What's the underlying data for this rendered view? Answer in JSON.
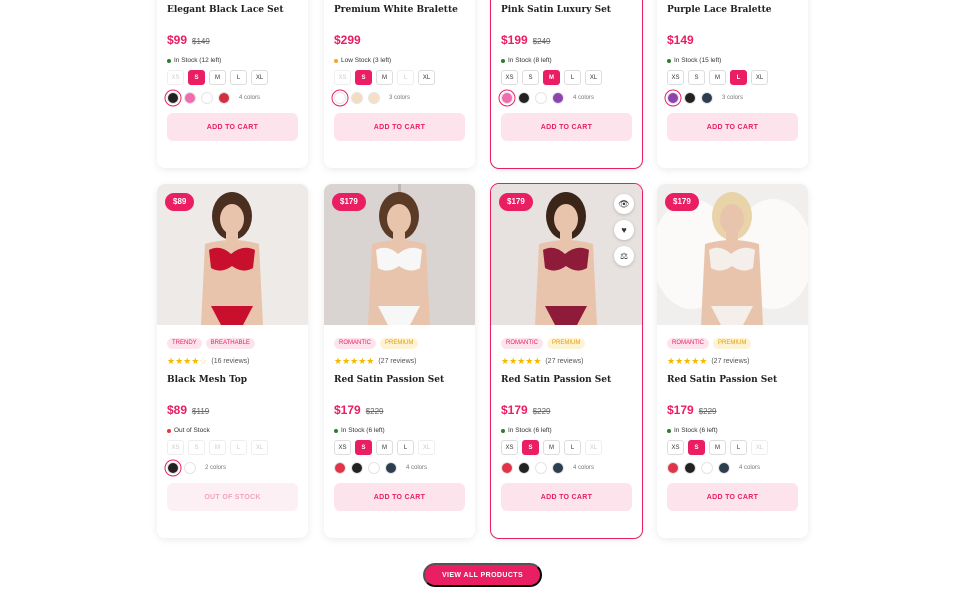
{
  "products_top": [
    {
      "title": "Elegant Black Lace Set",
      "price": "$99",
      "old_price": "$149",
      "stock": "In Stock (12 left)",
      "stock_color": "#2e7d32",
      "sizes": [
        {
          "label": "XS",
          "state": "disabled"
        },
        {
          "label": "S",
          "state": "active"
        },
        {
          "label": "M",
          "state": ""
        },
        {
          "label": "L",
          "state": ""
        },
        {
          "label": "XL",
          "state": ""
        }
      ],
      "colors": [
        "#222222",
        "#f06bb0",
        "#ffffff",
        "#d32f3f"
      ],
      "selected_color": 0,
      "color_count": "4 colors",
      "button": "ADD TO CART",
      "highlight": false
    },
    {
      "title": "Premium White Bralette",
      "price": "$299",
      "old_price": "",
      "stock": "Low Stock (3 left)",
      "stock_color": "#f5a623",
      "sizes": [
        {
          "label": "XS",
          "state": "disabled"
        },
        {
          "label": "S",
          "state": "active"
        },
        {
          "label": "M",
          "state": ""
        },
        {
          "label": "L",
          "state": "disabled"
        },
        {
          "label": "XL",
          "state": ""
        }
      ],
      "colors": [
        "#ffffff",
        "#f3dcc0",
        "#f5e0c6"
      ],
      "selected_color": 0,
      "color_count": "3 colors",
      "button": "ADD TO CART",
      "highlight": false
    },
    {
      "title": "Pink Satin Luxury Set",
      "price": "$199",
      "old_price": "$249",
      "stock": "In Stock (8 left)",
      "stock_color": "#2e7d32",
      "sizes": [
        {
          "label": "XS",
          "state": ""
        },
        {
          "label": "S",
          "state": ""
        },
        {
          "label": "M",
          "state": "active"
        },
        {
          "label": "L",
          "state": ""
        },
        {
          "label": "XL",
          "state": ""
        }
      ],
      "colors": [
        "#f06bb0",
        "#222222",
        "#ffffff",
        "#8e44ad"
      ],
      "selected_color": 0,
      "color_count": "4 colors",
      "button": "ADD TO CART",
      "highlight": true
    },
    {
      "title": "Purple Lace Bralette",
      "price": "$149",
      "old_price": "",
      "stock": "In Stock (15 left)",
      "stock_color": "#2e7d32",
      "sizes": [
        {
          "label": "XS",
          "state": ""
        },
        {
          "label": "S",
          "state": ""
        },
        {
          "label": "M",
          "state": ""
        },
        {
          "label": "L",
          "state": "active"
        },
        {
          "label": "XL",
          "state": ""
        }
      ],
      "colors": [
        "#8e44ad",
        "#222222",
        "#2c3e50"
      ],
      "selected_color": 0,
      "color_count": "3 colors",
      "button": "ADD TO CART",
      "highlight": false
    }
  ],
  "products_bottom": [
    {
      "badge": "$89",
      "tags": [
        {
          "label": "TRENDY",
          "style": "pink"
        },
        {
          "label": "BREATHABLE",
          "style": "pink"
        }
      ],
      "stars": 4,
      "reviews": "(16 reviews)",
      "title": "Black Mesh Top",
      "price": "$89",
      "old_price": "$119",
      "stock": "Out of Stock",
      "stock_color": "#e53935",
      "sizes": [
        {
          "label": "XS",
          "state": "disabled"
        },
        {
          "label": "S",
          "state": "disabled"
        },
        {
          "label": "M",
          "state": "disabled"
        },
        {
          "label": "L",
          "state": "disabled"
        },
        {
          "label": "XL",
          "state": "disabled"
        }
      ],
      "colors": [
        "#222222",
        "#ffffff"
      ],
      "selected_color": 0,
      "color_count": "2 colors",
      "button": "OUT OF STOCK",
      "button_disabled": true,
      "photo": "red",
      "highlight": false,
      "icons": false
    },
    {
      "badge": "$179",
      "tags": [
        {
          "label": "ROMANTIC",
          "style": "pink"
        },
        {
          "label": "PREMIUM",
          "style": "yellow"
        }
      ],
      "stars": 5,
      "reviews": "(27 reviews)",
      "title": "Red Satin Passion Set",
      "price": "$179",
      "old_price": "$229",
      "stock": "In Stock (6 left)",
      "stock_color": "#2e7d32",
      "sizes": [
        {
          "label": "XS",
          "state": ""
        },
        {
          "label": "S",
          "state": "active"
        },
        {
          "label": "M",
          "state": ""
        },
        {
          "label": "L",
          "state": ""
        },
        {
          "label": "XL",
          "state": "disabled"
        }
      ],
      "colors": [
        "#e0344a",
        "#222222",
        "#ffffff",
        "#2c3e50"
      ],
      "selected_color": -1,
      "color_count": "4 colors",
      "button": "ADD TO CART",
      "button_disabled": false,
      "photo": "white",
      "highlight": false,
      "icons": false
    },
    {
      "badge": "$179",
      "tags": [
        {
          "label": "ROMANTIC",
          "style": "pink"
        },
        {
          "label": "PREMIUM",
          "style": "yellow"
        }
      ],
      "stars": 5,
      "reviews": "(27 reviews)",
      "title": "Red Satin Passion Set",
      "price": "$179",
      "old_price": "$229",
      "stock": "In Stock (6 left)",
      "stock_color": "#2e7d32",
      "sizes": [
        {
          "label": "XS",
          "state": ""
        },
        {
          "label": "S",
          "state": "active"
        },
        {
          "label": "M",
          "state": ""
        },
        {
          "label": "L",
          "state": ""
        },
        {
          "label": "XL",
          "state": "disabled"
        }
      ],
      "colors": [
        "#e0344a",
        "#222222",
        "#ffffff",
        "#2c3e50"
      ],
      "selected_color": -1,
      "color_count": "4 colors",
      "button": "ADD TO CART",
      "button_disabled": false,
      "photo": "burgundy",
      "highlight": true,
      "icons": true
    },
    {
      "badge": "$179",
      "tags": [
        {
          "label": "ROMANTIC",
          "style": "pink"
        },
        {
          "label": "PREMIUM",
          "style": "yellow"
        }
      ],
      "stars": 5,
      "reviews": "(27 reviews)",
      "title": "Red Satin Passion Set",
      "price": "$179",
      "old_price": "$229",
      "stock": "In Stock (6 left)",
      "stock_color": "#2e7d32",
      "sizes": [
        {
          "label": "XS",
          "state": ""
        },
        {
          "label": "S",
          "state": "active"
        },
        {
          "label": "M",
          "state": ""
        },
        {
          "label": "L",
          "state": ""
        },
        {
          "label": "XL",
          "state": "disabled"
        }
      ],
      "colors": [
        "#e0344a",
        "#222222",
        "#ffffff",
        "#2c3e50"
      ],
      "selected_color": -1,
      "color_count": "4 colors",
      "button": "ADD TO CART",
      "button_disabled": false,
      "photo": "angel",
      "highlight": false,
      "icons": false
    }
  ],
  "view_all_label": "VIEW ALL PRODUCTS",
  "accent_color": "#e91e63"
}
